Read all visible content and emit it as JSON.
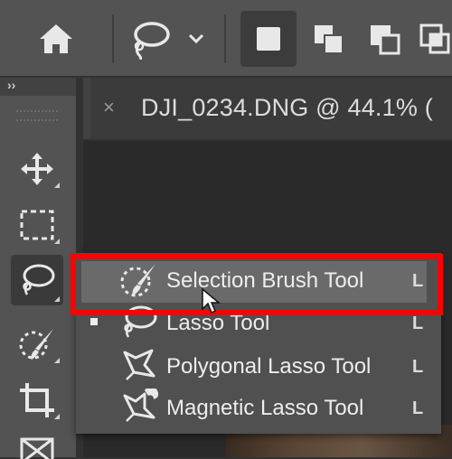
{
  "document": {
    "tab_title": "DJI_0234.DNG @ 44.1% (",
    "close_glyph": "×"
  },
  "options_bar": {
    "home_icon": "home-icon",
    "active_tool_icon": "lasso-icon",
    "selection_modes": [
      "new-selection",
      "add-to-selection",
      "subtract-from-selection",
      "intersect-with-selection"
    ]
  },
  "toolbar": {
    "collapse_glyph": "››",
    "tools": [
      "move-icon",
      "rectangular-marquee-icon",
      "lasso-icon",
      "selection-brush-icon",
      "crop-icon",
      "frame-icon"
    ]
  },
  "flyout": {
    "items": [
      {
        "label": "Selection Brush Tool",
        "shortcut": "L",
        "selected": false,
        "hovered": true
      },
      {
        "label": "Lasso Tool",
        "shortcut": "L",
        "selected": true,
        "hovered": false
      },
      {
        "label": "Polygonal Lasso Tool",
        "shortcut": "L",
        "selected": false,
        "hovered": false
      },
      {
        "label": "Magnetic Lasso Tool",
        "shortcut": "L",
        "selected": false,
        "hovered": false
      }
    ]
  },
  "colors": {
    "highlight": "#ff0000",
    "panel": "#535353",
    "canvas": "#2a2a2a"
  }
}
